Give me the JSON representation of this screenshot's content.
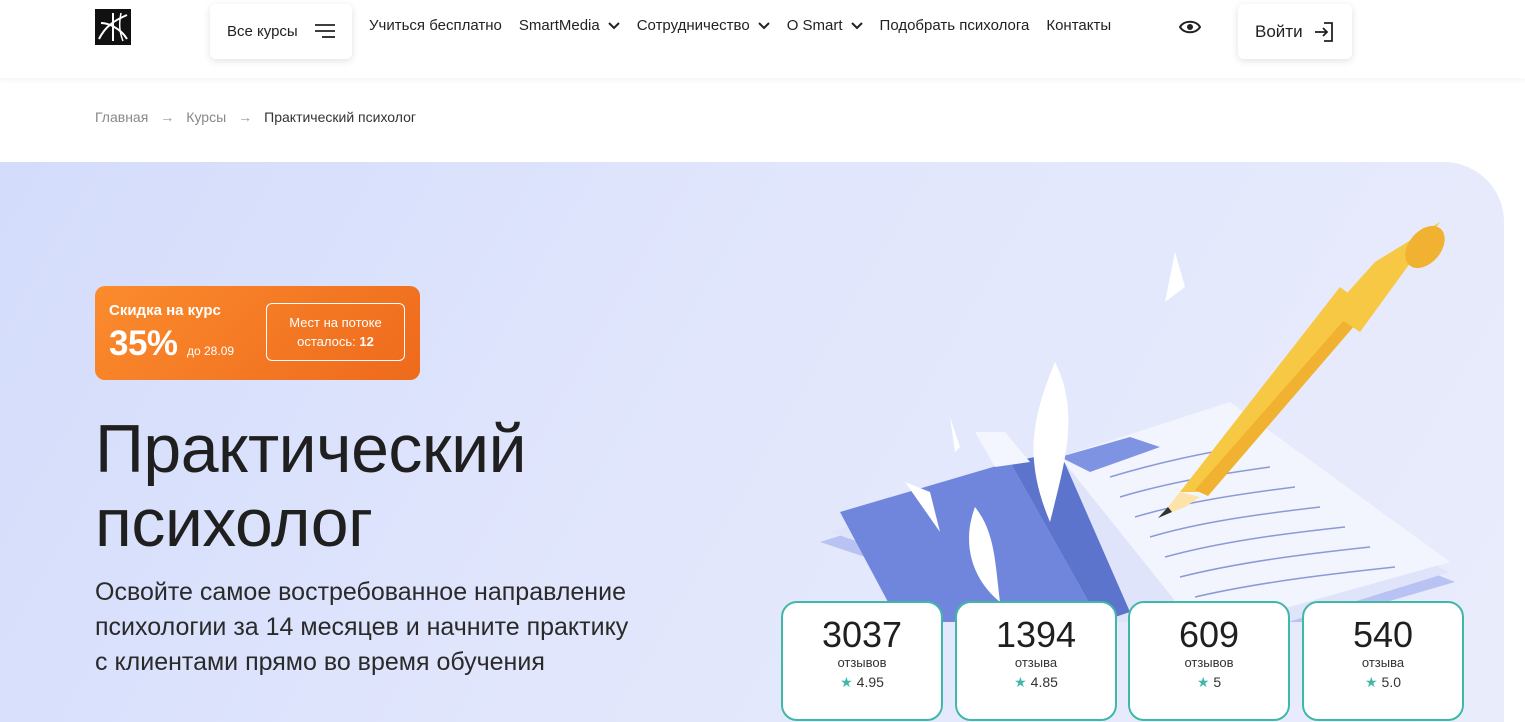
{
  "header": {
    "logo_name": "smart-logo",
    "all_courses_label": "Все курсы",
    "nav": [
      {
        "label": "Учиться бесплатно",
        "dropdown": false
      },
      {
        "label": "SmartMedia",
        "dropdown": true
      },
      {
        "label": "Сотрудничество",
        "dropdown": true
      },
      {
        "label": "О Smart",
        "dropdown": true
      },
      {
        "label": "Подобрать психолога",
        "dropdown": false
      },
      {
        "label": "Контакты",
        "dropdown": false
      }
    ],
    "login_label": "Войти"
  },
  "breadcrumb": {
    "items": [
      "Главная",
      "Курсы"
    ],
    "separator": "→",
    "current": "Практический психолог"
  },
  "promo": {
    "discount_label": "Скидка на курс",
    "discount_value": "35%",
    "discount_until": "до 28.09",
    "seats_line1": "Мест на потоке",
    "seats_line2": "осталось:",
    "seats_count": "12"
  },
  "hero": {
    "title_line1": "Практический",
    "title_line2": "психолог",
    "subtitle_line1": "Освойте самое востребованное направление",
    "subtitle_line2": "психологии за 14 месяцев и начните практику",
    "subtitle_line3": "с клиентами прямо во время обучения"
  },
  "stats": [
    {
      "number": "3037",
      "label": "отзывов",
      "rating": "4.95"
    },
    {
      "number": "1394",
      "label": "отзыва",
      "rating": "4.85"
    },
    {
      "number": "609",
      "label": "отзывов",
      "rating": "5"
    },
    {
      "number": "540",
      "label": "отзыва",
      "rating": "5.0"
    }
  ],
  "colors": {
    "accent_orange": "#f07320",
    "hero_bg": "#dde3fb",
    "stat_border": "#3fb8a8",
    "book_blue": "#6f86dc",
    "pen_yellow": "#f7c843"
  }
}
